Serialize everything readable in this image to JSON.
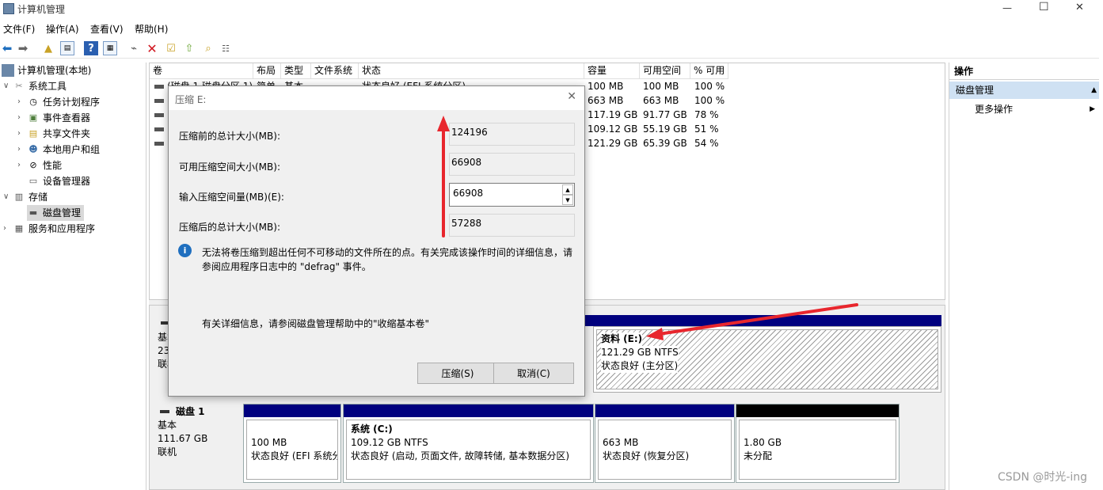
{
  "window": {
    "title": "计算机管理",
    "controls": {
      "minimize": "—",
      "maximize": "☐",
      "close": "✕"
    }
  },
  "menu": [
    "文件(F)",
    "操作(A)",
    "查看(V)",
    "帮助(H)"
  ],
  "tree": {
    "root": "计算机管理(本地)",
    "items": [
      {
        "label": "系统工具"
      },
      {
        "label": "任务计划程序"
      },
      {
        "label": "事件查看器"
      },
      {
        "label": "共享文件夹"
      },
      {
        "label": "本地用户和组"
      },
      {
        "label": "性能"
      },
      {
        "label": "设备管理器"
      },
      {
        "label": "存储"
      },
      {
        "label": "磁盘管理"
      },
      {
        "label": "服务和应用程序"
      }
    ]
  },
  "volume_list": {
    "columns": [
      "卷",
      "布局",
      "类型",
      "文件系统",
      "状态",
      "容量",
      "可用空间",
      "% 可用"
    ],
    "rows": [
      {
        "vol": "(磁盘 1 磁盘分区 1)",
        "layout": "简单",
        "type": "基本",
        "fs": "",
        "status": "状态良好 (EFI 系统分区)",
        "cap": "100 MB",
        "free": "100 MB",
        "pct": "100 %"
      },
      {
        "vol": "(",
        "layout": "",
        "type": "",
        "fs": "",
        "status": "",
        "cap": "663 MB",
        "free": "663 MB",
        "pct": "100 %"
      },
      {
        "vol": "",
        "layout": "",
        "type": "",
        "fs": "",
        "status": "",
        "cap": "117.19 GB",
        "free": "91.77 GB",
        "pct": "78 %"
      },
      {
        "vol": "",
        "layout": "",
        "type": "",
        "fs": "",
        "status": "",
        "cap": "109.12 GB",
        "free": "55.19 GB",
        "pct": "51 %"
      },
      {
        "vol": "",
        "layout": "",
        "type": "",
        "fs": "",
        "status": "",
        "cap": "121.29 GB",
        "free": "65.39 GB",
        "pct": "54 %"
      }
    ]
  },
  "disk0": {
    "info": [
      "基本",
      "23",
      "联机"
    ],
    "partition_e": {
      "name": "资料 (E:)",
      "size": "121.29 GB NTFS",
      "status": "状态良好 (主分区)"
    }
  },
  "disk1": {
    "title": "磁盘 1",
    "info": [
      "基本",
      "111.67 GB",
      "联机"
    ],
    "partitions": [
      {
        "name": "",
        "size": "100 MB",
        "status": "状态良好 (EFI 系统分"
      },
      {
        "name": "系统 (C:)",
        "size": "109.12 GB NTFS",
        "status": "状态良好 (启动, 页面文件, 故障转储, 基本数据分区)"
      },
      {
        "name": "",
        "size": "663 MB",
        "status": "状态良好 (恢复分区)"
      },
      {
        "name": "",
        "size": "1.80 GB",
        "status": "未分配"
      }
    ]
  },
  "actions": {
    "header": "操作",
    "section": "磁盘管理",
    "more": "更多操作"
  },
  "dialog": {
    "title": "压缩 E:",
    "total_before_label": "压缩前的总计大小(MB):",
    "total_before_value": "124196",
    "available_label": "可用压缩空间大小(MB):",
    "available_value": "66908",
    "input_label": "输入压缩空间量(MB)(E):",
    "input_value": "66908",
    "total_after_label": "压缩后的总计大小(MB):",
    "total_after_value": "57288",
    "info_line1": "无法将卷压缩到超出任何不可移动的文件所在的点。有关完成该操作时间的详细信息，请",
    "info_line2": "参阅应用程序日志中的 \"defrag\" 事件。",
    "help_text": "有关详细信息，请参阅磁盘管理帮助中的\"收缩基本卷\"",
    "shrink_button": "压缩(S)",
    "cancel_button": "取消(C)"
  },
  "watermark": "CSDN @时光-ing",
  "colors": {
    "primary_partition_bar": "#00007f",
    "unallocated_bar": "#000000",
    "annotation_arrow": "#e8262d",
    "actions_section_bg": "#cfe1f3"
  }
}
